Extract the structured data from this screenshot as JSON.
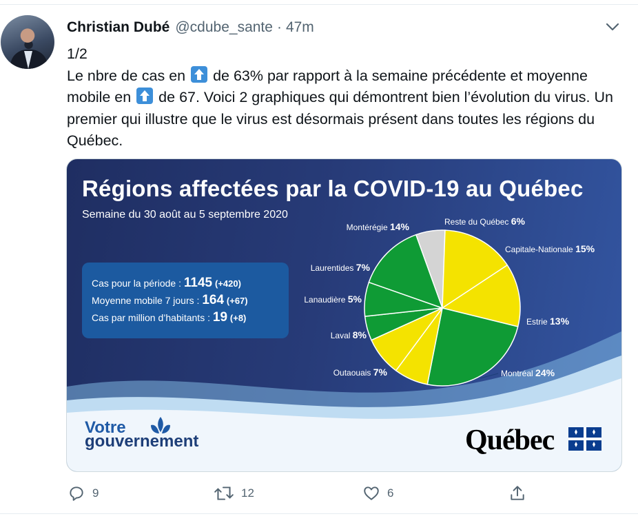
{
  "tweet": {
    "author_name": "Christian Dubé",
    "handle": "@cdube_sante",
    "separator": "·",
    "time": "47m",
    "text_line1": "1/2",
    "text_a": "Le nbre de cas en ",
    "text_b": " de 63% par rapport à la semaine précédente et moyenne mobile en ",
    "text_c": " de 67. Voici 2 graphiques qui démontrent bien l’évolution du virus. Un premier qui illustre que le virus est désormais présent dans toutes les régions du Québec.",
    "up_emoji_icon": "up-arrow-emoji"
  },
  "image": {
    "title": "Régions affectées par la COVID-19 au Québec",
    "subtitle": "Semaine du 30 août au 5 septembre 2020",
    "stats": {
      "cases_label": "Cas pour la période : ",
      "cases_value": "1145",
      "cases_change": "(+420)",
      "avg_label": "Moyenne mobile 7 jours : ",
      "avg_value": "164",
      "avg_change": "(+67)",
      "million_label": "Cas par million d’habitants : ",
      "million_value": "19",
      "million_change": "(+8)"
    },
    "logo_votre": "Votre",
    "logo_gouvernement": "gouvernement",
    "logo_quebec": "Québec",
    "colors": {
      "green": "#0f9b35",
      "yellow": "#f4e300",
      "gray": "#d4d4d4",
      "bg": "#273b78"
    }
  },
  "chart_data": {
    "type": "pie",
    "title": "Régions affectées par la COVID-19 au Québec",
    "subtitle": "Semaine du 30 août au 5 septembre 2020",
    "slices": [
      {
        "label": "Reste du Québec",
        "value": 6,
        "color": "#d4d4d4"
      },
      {
        "label": "Capitale-Nationale",
        "value": 15,
        "color": "#f4e300"
      },
      {
        "label": "Estrie",
        "value": 13,
        "color": "#f4e300"
      },
      {
        "label": "Montréal",
        "value": 24,
        "color": "#0f9b35"
      },
      {
        "label": "Outaouais",
        "value": 7,
        "color": "#f4e300"
      },
      {
        "label": "Laval",
        "value": 8,
        "color": "#f4e300"
      },
      {
        "label": "Lanaudière",
        "value": 5,
        "color": "#0f9b35"
      },
      {
        "label": "Laurentides",
        "value": 7,
        "color": "#0f9b35"
      },
      {
        "label": "Montérégie",
        "value": 14,
        "color": "#0f9b35"
      }
    ],
    "value_suffix": "%"
  },
  "actions": {
    "reply_count": "9",
    "retweet_count": "12",
    "like_count": "6"
  }
}
